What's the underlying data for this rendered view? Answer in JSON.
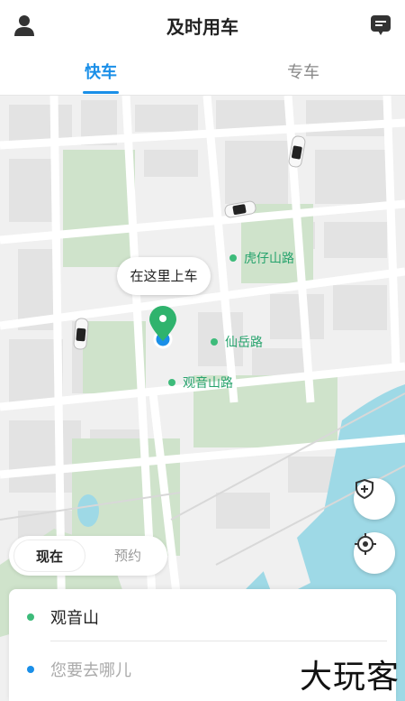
{
  "header": {
    "title": "及时用车",
    "profile_icon": "user-icon",
    "message_icon": "message-icon"
  },
  "tabs": [
    {
      "label": "快车",
      "active": true
    },
    {
      "label": "专车",
      "active": false
    }
  ],
  "map": {
    "pickup_bubble": "在这里上车",
    "pois": [
      {
        "name": "虎仔山路"
      },
      {
        "name": "仙岳路"
      },
      {
        "name": "观音山路"
      }
    ],
    "colors": {
      "water": "#9ed9e6",
      "park": "#cfe3cb",
      "road": "#ffffff",
      "block": "#e6e6e6",
      "pin": "#2fb36d",
      "location": "#1a8fe8"
    }
  },
  "time_toggle": {
    "now": "现在",
    "reserve": "预约"
  },
  "address": {
    "start": "观音山",
    "destination_placeholder": "您要去哪儿"
  },
  "watermark": "大玩客"
}
